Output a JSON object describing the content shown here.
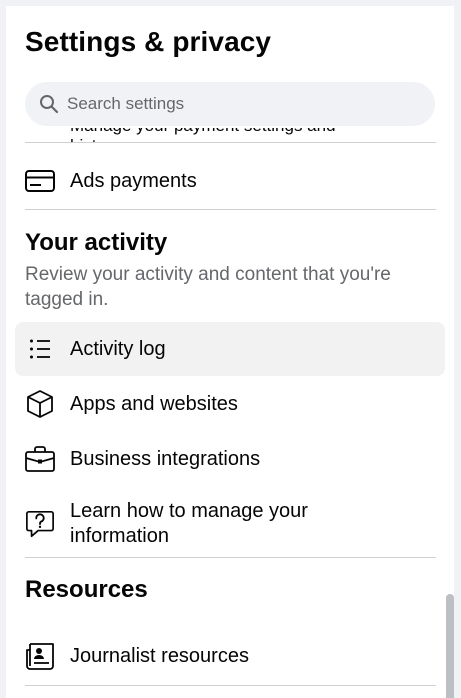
{
  "header": {
    "title": "Settings & privacy"
  },
  "search": {
    "placeholder": "Search settings"
  },
  "partial_item": {
    "label": "Manage your payment settings and history"
  },
  "items_top": [
    {
      "label": "Ads payments",
      "icon": "credit-card-icon"
    }
  ],
  "activity": {
    "title": "Your activity",
    "subtitle": "Review your activity and content that you're tagged in.",
    "items": [
      {
        "label": "Activity log",
        "icon": "list-icon"
      },
      {
        "label": "Apps and websites",
        "icon": "cube-icon"
      },
      {
        "label": "Business integrations",
        "icon": "briefcase-icon"
      },
      {
        "label": "Learn how to manage your information",
        "icon": "question-chat-icon"
      }
    ]
  },
  "resources": {
    "title": "Resources",
    "items": [
      {
        "label": "Journalist resources",
        "icon": "newspaper-icon"
      }
    ]
  },
  "colors": {
    "text": "#050505",
    "secondary": "#65676b",
    "divider": "#ced0d4",
    "hover": "#f2f2f2"
  }
}
